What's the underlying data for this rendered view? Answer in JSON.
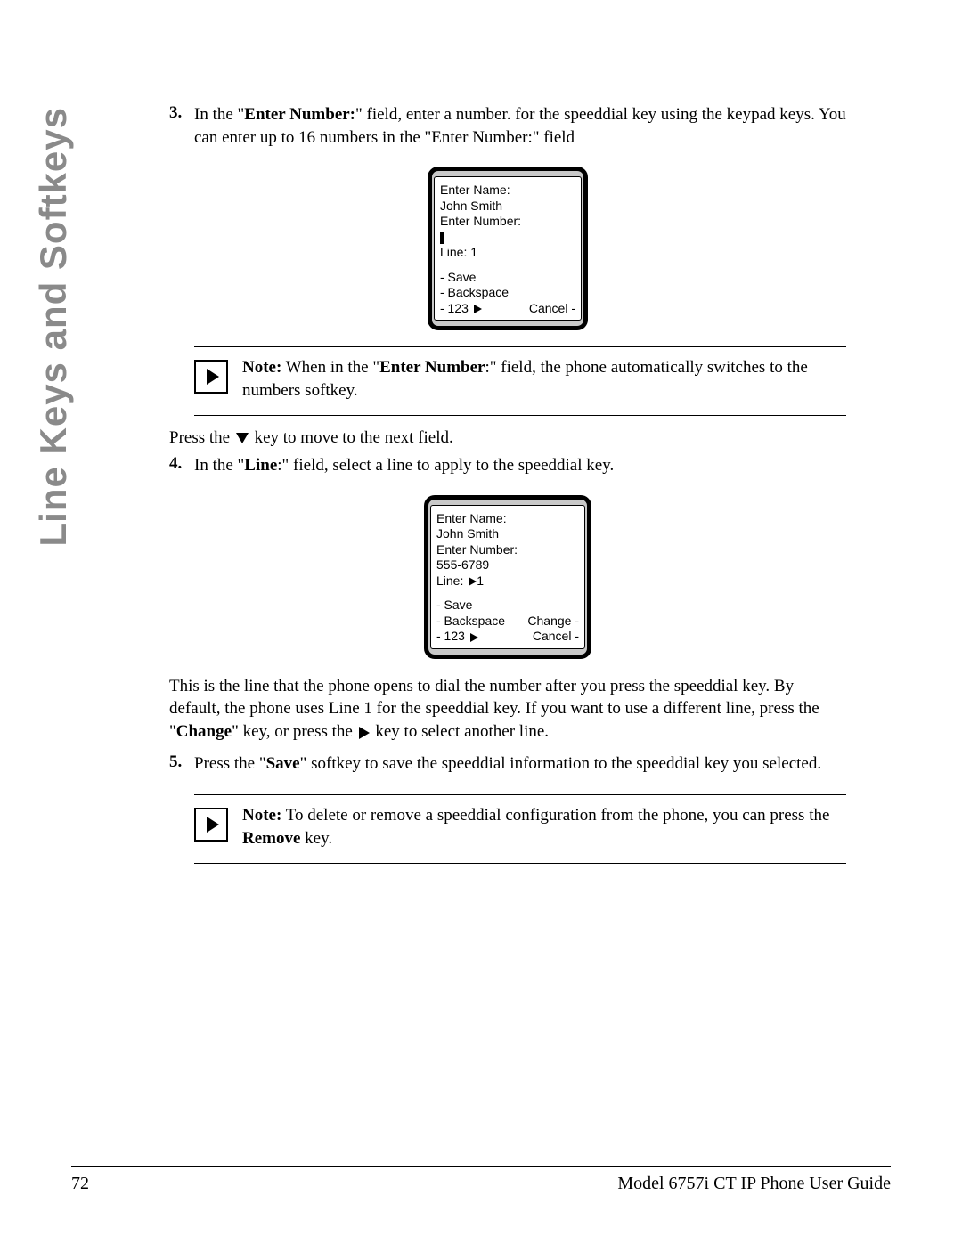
{
  "sidebar": {
    "section_title": "Line Keys and Softkeys"
  },
  "steps": {
    "s3": {
      "num": "3.",
      "body_1a": "In the \"",
      "body_1b": "Enter Number:",
      "body_1c": "\" field, enter a number. for the speeddial key using the keypad keys. You can enter up to 16 numbers in the \"Enter Number:\" field"
    },
    "s3_after_1": "Press the ",
    "s3_after_2": " key to move to the next field.",
    "s4": {
      "num": "4.",
      "body_1a": "In the \"",
      "body_1b": "Line",
      "body_1c": ":\" field, select a line to apply to the speeddial key."
    },
    "s4_para_a": "This is the line that the phone opens to dial the number after you press the speeddial key. By default, the phone uses Line 1 for the speeddial key. If you want to use a different line, press the \"",
    "s4_para_b": "Change",
    "s4_para_c": "\" key, or press the ",
    "s4_para_d": " key to select another line.",
    "s5": {
      "num": "5.",
      "body_1a": "Press the \"",
      "body_1b": "Save",
      "body_1c": "\" softkey to save the speeddial information to the speeddial key you selected."
    }
  },
  "note1": {
    "label": "Note:",
    "t1": " When in the \"",
    "t2": "Enter Number",
    "t3": ":\" field, the phone automatically switches to the numbers softkey."
  },
  "note2": {
    "label": "Note:",
    "t1": " To delete or remove a speeddial configuration from the phone, you can press the ",
    "t2": "Remove",
    "t3": " key."
  },
  "screen1": {
    "enter_name_label": "Enter Name:",
    "name_value": "John Smith",
    "enter_number_label": "Enter Number:",
    "line_label": "Line: 1",
    "sk_save": "- Save",
    "sk_backspace": "- Backspace",
    "sk_123": "- 123",
    "sk_cancel": "Cancel -"
  },
  "screen2": {
    "enter_name_label": "Enter Name:",
    "name_value": "John Smith",
    "enter_number_label": "Enter Number:",
    "number_value": "555-6789",
    "line_label": "Line: ",
    "line_value": "1",
    "sk_save": "- Save",
    "sk_backspace": "- Backspace",
    "sk_123": "- 123",
    "sk_change": "Change -",
    "sk_cancel": "Cancel -"
  },
  "footer": {
    "page": "72",
    "title": "Model 6757i CT IP Phone User Guide"
  }
}
